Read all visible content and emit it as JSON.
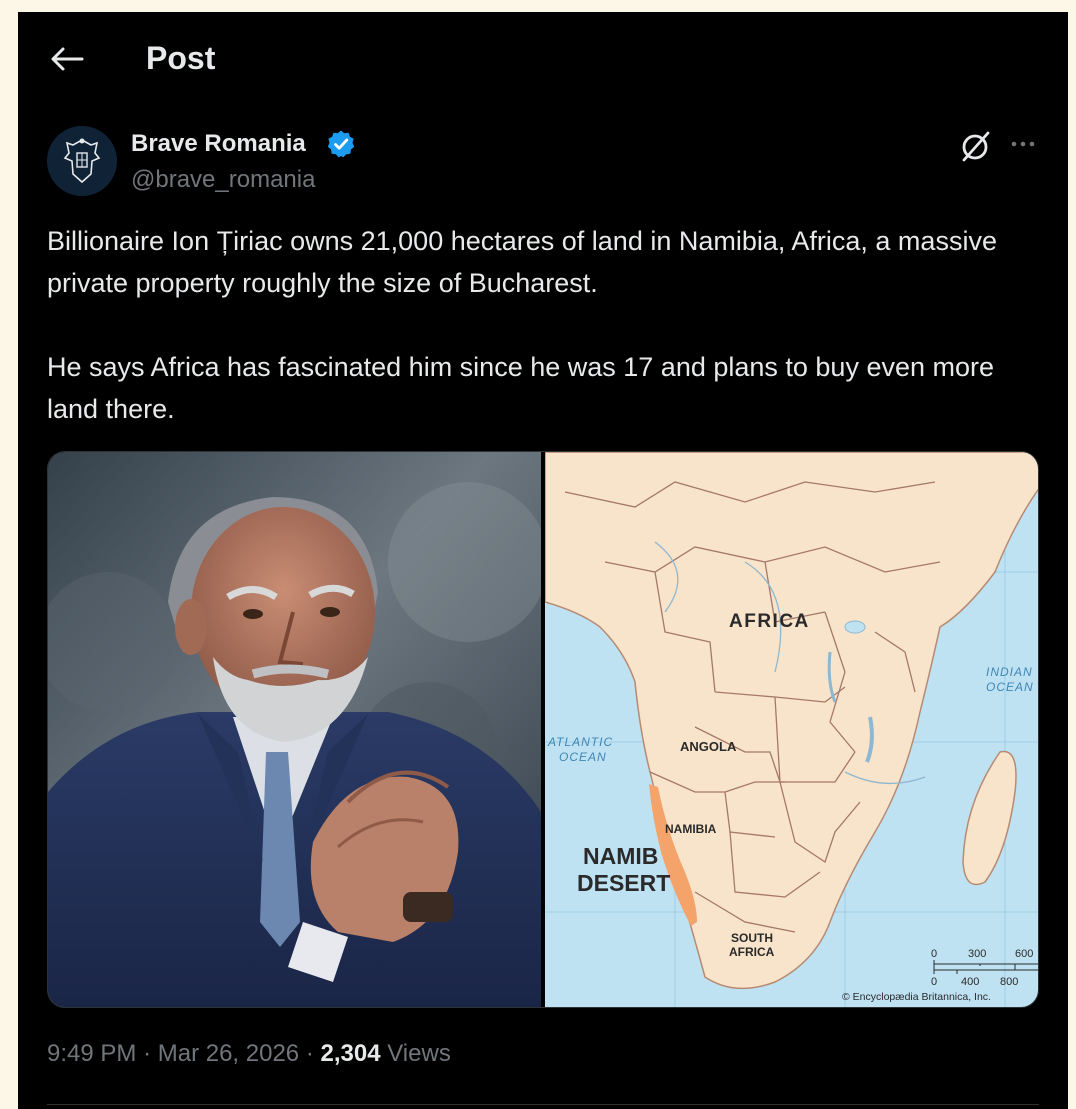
{
  "header": {
    "title": "Post"
  },
  "author": {
    "name": "Brave Romania",
    "handle": "@brave_romania",
    "verified": true
  },
  "tweet": {
    "paragraphs": [
      "Billionaire Ion Țiriac owns 21,000 hectares of land in Namibia, Africa, a massive private property roughly the size of Bucharest.",
      "He says Africa has fascinated him since he was 17 and plans to buy even more land there."
    ]
  },
  "map": {
    "africa": "AFRICA",
    "indian_ocean_1": "INDIAN",
    "indian_ocean_2": "OCEAN",
    "atlantic_ocean_1": "ATLANTIC",
    "atlantic_ocean_2": "OCEAN",
    "angola": "ANGOLA",
    "namibia": "NAMIBIA",
    "namib_1": "NAMIB",
    "namib_2": "DESERT",
    "south_africa_1": "SOUTH",
    "south_africa_2": "AFRICA",
    "scale_top": [
      "0",
      "300",
      "600"
    ],
    "scale_bottom": [
      "0",
      "400",
      "800"
    ],
    "credit": "© Encyclopædia Britannica, Inc."
  },
  "meta": {
    "time": "9:49 PM",
    "separator": "·",
    "date": "Mar 26, 2026",
    "views_count": "2,304",
    "views_label": "Views"
  },
  "colors": {
    "background": "#000000",
    "text": "#e7e9ea",
    "muted": "#71767b",
    "verified": "#1d9bf0",
    "desert": "#f4a46a"
  }
}
